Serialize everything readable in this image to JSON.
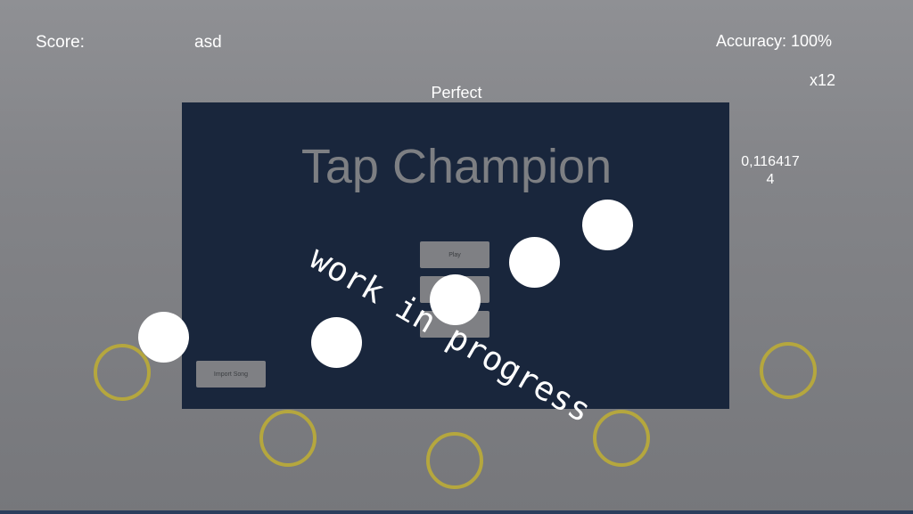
{
  "hud": {
    "score_label": "Score:",
    "score_value": "asd",
    "accuracy": "Accuracy: 100%",
    "combo": "x12",
    "judgement": "Perfect",
    "debug_line1": "0,116417",
    "debug_line2": "4"
  },
  "menu": {
    "title": "Tap Champion",
    "buttons": [
      "Play",
      "",
      ""
    ],
    "import_button": "Import Song"
  },
  "overlay": {
    "watermark": "work in progress"
  },
  "colors": {
    "panel": "#19263c",
    "lane_ring": "#b5a73e",
    "note": "#ffffff"
  }
}
